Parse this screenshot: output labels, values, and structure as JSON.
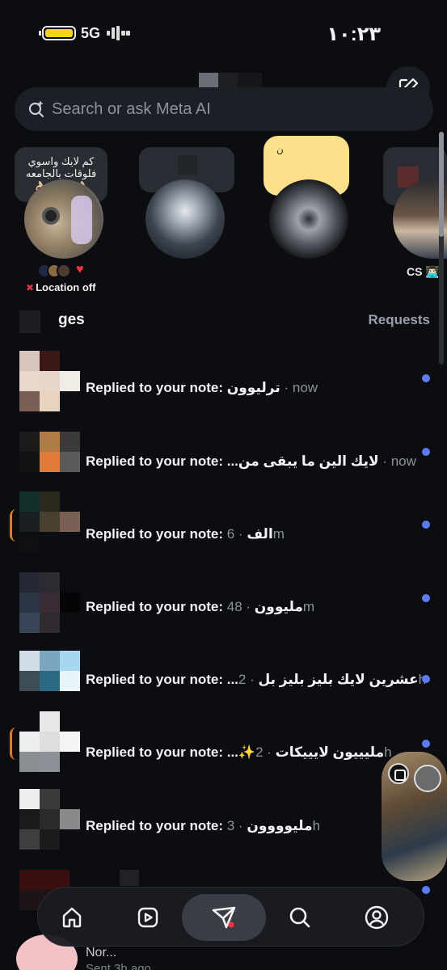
{
  "status_bar": {
    "network": "5G",
    "time": "١٠:٢٣"
  },
  "header": {
    "compose_icon": "edit-square-icon"
  },
  "search": {
    "placeholder": "Search or ask Meta AI",
    "icon": "meta-ai-search-icon"
  },
  "notes": {
    "my_note": {
      "text": "كم لايك واسوي فلوقات بالجامعه",
      "emoji": "👌🏻👌🏻☝🏻👌🏻"
    },
    "yellow_note_text": "ن",
    "location_off_label": "Location off",
    "cs_label": "CS 👨🏻‍💻"
  },
  "messages_section": {
    "title_visible": "ges",
    "requests_label": "Requests"
  },
  "messages": [
    {
      "prefix": "Replied to your note: ",
      "body": "ترليوون",
      "time": "now",
      "unread": true
    },
    {
      "prefix": "Replied to your note: ",
      "body": "...لايك الين ما يبقى من",
      "time": "now",
      "unread": true
    },
    {
      "prefix": "Replied to your note: ",
      "body": "الف",
      "time": "6m",
      "unread": true
    },
    {
      "prefix": "Replied to your note: ",
      "body": "مليوون",
      "time": "48m",
      "unread": true
    },
    {
      "prefix": "Replied to your note: ",
      "body": "...عشرين لايك بليز بليز بل",
      "time": "2h",
      "unread": true
    },
    {
      "prefix": "Replied to your note: ",
      "body": "...✨مليييون لايييكات",
      "time": "2h",
      "unread": true
    },
    {
      "prefix": "Replied to your note: ",
      "body": "مليوووون",
      "time": "3h",
      "unread": true
    }
  ],
  "partial_row": {
    "name": "Nor...",
    "sub": "Sent 3h ago"
  },
  "tab_bar": {
    "items": [
      "home-icon",
      "reels-icon",
      "messages-icon",
      "search-icon",
      "profile-icon"
    ],
    "active": "messages-icon"
  },
  "colors": {
    "background": "#0b0d11",
    "unread_dot": "#5a7cf0",
    "accent_red": "#ff3040"
  }
}
